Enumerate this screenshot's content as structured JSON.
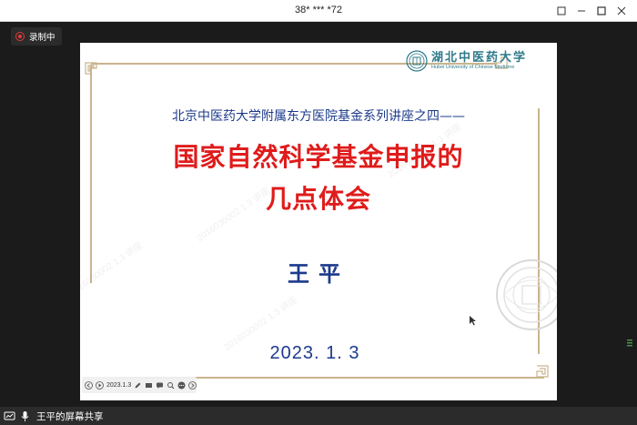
{
  "window": {
    "title": "38* *** *72"
  },
  "recording": {
    "label": "录制中"
  },
  "slide": {
    "logo_cn": "湖北中医药大学",
    "logo_en": "Hubei University of Chinese Medicine",
    "subtitle": "北京中医药大学附属东方医院基金系列讲座之四——",
    "title_line1": "国家自然科学基金申报的",
    "title_line2": "几点体会",
    "author": "王平",
    "date": "2023. 1. 3",
    "toolbar_text": "2023.1.3"
  },
  "share": {
    "label": "王平的屏幕共享"
  },
  "colors": {
    "title_red": "#e01b1b",
    "navy": "#1c3a8c",
    "logo_teal": "#2e7a8a",
    "frame_gold": "#c9b48d"
  }
}
